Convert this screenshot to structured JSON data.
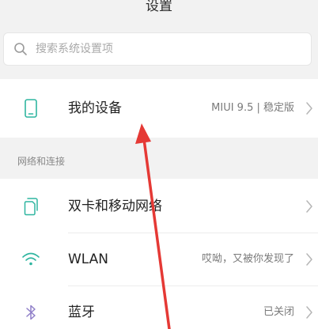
{
  "header": {
    "title": "设置"
  },
  "search": {
    "placeholder": "搜索系统设置项",
    "icon": "search-icon"
  },
  "device": {
    "label": "我的设备",
    "value": "MIUI 9.5 | 稳定版",
    "icon": "phone-icon"
  },
  "network_section": {
    "header": "网络和连接",
    "items": [
      {
        "label": "双卡和移动网络",
        "value": "",
        "icon": "sim-cards-icon"
      },
      {
        "label": "WLAN",
        "value": "哎呦，又被你发现了",
        "icon": "wifi-icon"
      },
      {
        "label": "蓝牙",
        "value": "已关闭",
        "icon": "bluetooth-icon"
      }
    ]
  },
  "colors": {
    "background": "#f2f2f2",
    "card": "#ffffff",
    "annotation_arrow": "#e53935",
    "icon_teal": "#2fb5a0"
  }
}
